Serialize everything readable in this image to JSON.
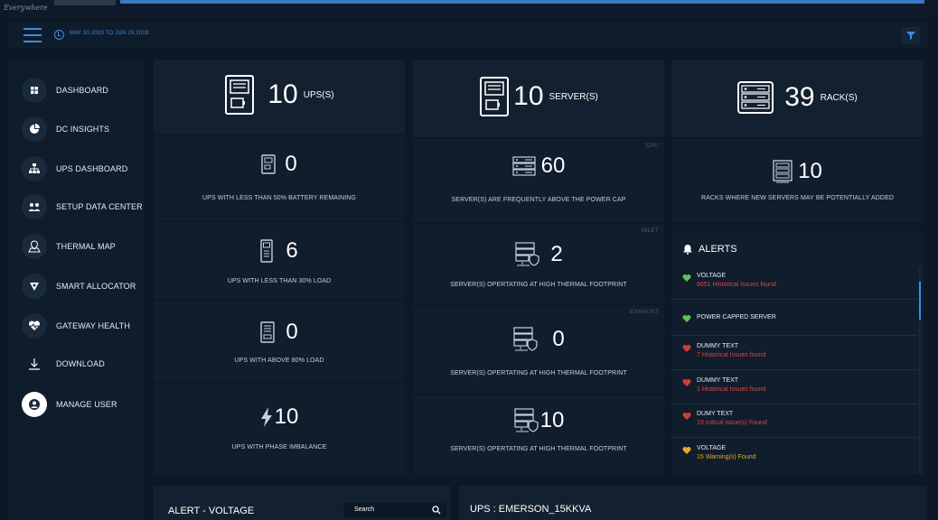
{
  "app": {
    "logo_text": "Everywhere"
  },
  "filterbar": {
    "date_range": "MAY 30,2019 TO JUN 29,2019"
  },
  "sidebar": {
    "items": [
      {
        "label": "DASHBOARD",
        "icon": "dashboard-icon"
      },
      {
        "label": "DC INSIGHTS",
        "icon": "pie-chart-icon"
      },
      {
        "label": "UPS DASHBOARD",
        "icon": "hierarchy-icon"
      },
      {
        "label": "SETUP DATA CENTER",
        "icon": "setup-people-icon"
      },
      {
        "label": "THERMAL MAP",
        "icon": "map-pin-icon"
      },
      {
        "label": "SMART ALLOCATOR",
        "icon": "allocator-icon"
      },
      {
        "label": "GATEWAY HEALTH",
        "icon": "heartbeat-icon"
      },
      {
        "label": "DOWNLOAD",
        "icon": "download-icon"
      },
      {
        "label": "MANAGE USER",
        "icon": "user-icon"
      }
    ]
  },
  "ups": {
    "total": "10",
    "unit": "UPS(S)",
    "battery": {
      "value": "0",
      "label": "UPS WITH LESS THAN 50% BATTERY REMAINING"
    },
    "low_load": {
      "value": "6",
      "label": "UPS WITH LESS THAN 30% LOAD"
    },
    "high_load": {
      "value": "0",
      "label": "UPS WITH ABOVE 80% LOAD"
    },
    "phase": {
      "value": "10",
      "label": "UPS WITH PHASE IMBALANCE"
    }
  },
  "server": {
    "total": "10",
    "unit": "SERVER(S)",
    "cpu": {
      "tag": "CPU",
      "value": "60",
      "label": "SERVER(S) ARE FREQUENTLY ABOVE THE POWER CAP"
    },
    "inlet": {
      "tag": "INLET",
      "value": "2",
      "label": "SERVER(S) OPERTATING AT HIGH  THERMAL FOOTPRINT"
    },
    "exhaust": {
      "tag": "EXHAUST",
      "value": "0",
      "label": "SERVER(S) OPERTATING AT HIGH  THERMAL FOOTPRINT"
    },
    "other": {
      "value": "10",
      "label": "SERVER(S) OPERTATING AT HIGH THERMAL FOOTPRINT"
    }
  },
  "rack": {
    "total": "39",
    "unit": "RACK(S)",
    "new": {
      "value": "10",
      "label": "RACKS WHERE NEW SERVERS MAY BE POTENTIALLY ADDED"
    }
  },
  "alerts": {
    "title": "ALERTS",
    "items": [
      {
        "title": "VOLTAGE",
        "detail": "6051 Historical Issues found",
        "status": "green"
      },
      {
        "title": "POWER CAPPED SERVER",
        "detail": "",
        "status": "green"
      },
      {
        "title": "DUMMY TEXT",
        "detail": "7 Historical Issues found",
        "status": "red"
      },
      {
        "title": "DUMMY TEXT",
        "detail": "1 Historical Issues found",
        "status": "red"
      },
      {
        "title": "DUMY TEXT",
        "detail": "19 critical issue(s) Found",
        "status": "red"
      },
      {
        "title": "VOLTAGE",
        "detail": "15 Warning(s) Found",
        "status": "yellow"
      }
    ]
  },
  "bottom": {
    "alert_title": "ALERT - VOLTAGE",
    "search_label": "Search",
    "ups_title": "UPS : EMERSON_15KKVA"
  },
  "colors": {
    "green": "#5cc44f",
    "red": "#d83a3a",
    "yellow": "#e6a92a",
    "accent": "#3f8de0",
    "red_text": "#e0434a",
    "yellow_text": "#e6a92a"
  }
}
